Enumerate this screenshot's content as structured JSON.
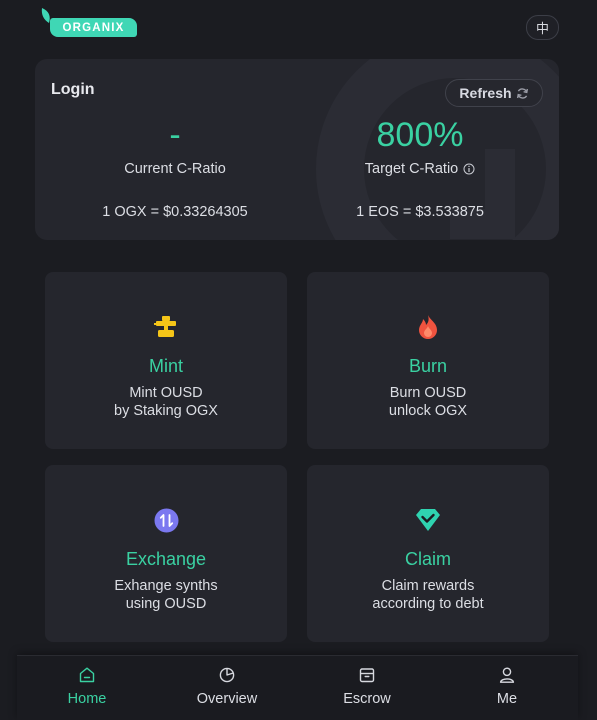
{
  "header": {
    "logo_text": "ORGANIX",
    "language_button": "中"
  },
  "stats": {
    "login_label": "Login",
    "refresh_label": "Refresh",
    "current_ratio_value": "-",
    "current_ratio_label": "Current C-Ratio",
    "target_ratio_value": "800%",
    "target_ratio_label": "Target C-Ratio",
    "ogx_price": "1 OGX = $0.33264305",
    "eos_price": "1 EOS = $3.533875"
  },
  "actions": [
    {
      "title": "Mint",
      "desc_line1": "Mint OUSD",
      "desc_line2": "by Staking OGX",
      "icon": "mint-icon"
    },
    {
      "title": "Burn",
      "desc_line1": "Burn OUSD",
      "desc_line2": "unlock OGX",
      "icon": "fire-icon"
    },
    {
      "title": "Exchange",
      "desc_line1": "Exhange synths",
      "desc_line2": "using OUSD",
      "icon": "swap-icon"
    },
    {
      "title": "Claim",
      "desc_line1": "Claim rewards",
      "desc_line2": "according to debt",
      "icon": "diamond-check-icon"
    }
  ],
  "nav": {
    "items": [
      {
        "label": "Home",
        "icon": "home-icon",
        "active": true
      },
      {
        "label": "Overview",
        "icon": "pie-chart-icon",
        "active": false
      },
      {
        "label": "Escrow",
        "icon": "box-icon",
        "active": false
      },
      {
        "label": "Me",
        "icon": "user-icon",
        "active": false
      }
    ]
  },
  "colors": {
    "accent": "#3ad1a2",
    "background": "#1b1c21",
    "card": "#25262d",
    "mint_icon": "#f5c518",
    "burn_icon": "#f0533f",
    "exchange_icon": "#7b78f0",
    "claim_icon": "#2fd3b0"
  }
}
